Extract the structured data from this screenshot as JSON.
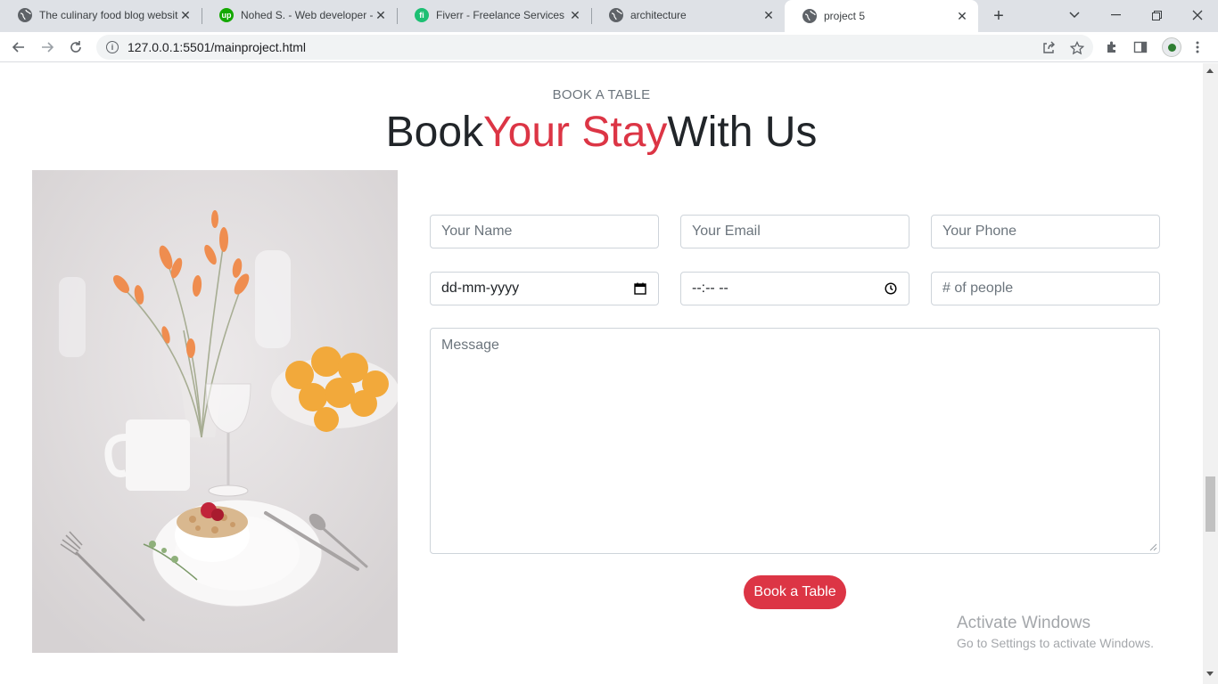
{
  "browser": {
    "tabs": [
      {
        "title": "The culinary food blog website",
        "favicon": "globe-icon",
        "active": false
      },
      {
        "title": "Nohed S. - Web developer - Upwork",
        "favicon": "upwork-icon",
        "active": false
      },
      {
        "title": "Fiverr - Freelance Services Marketplace",
        "favicon": "fiverr-icon",
        "active": false
      },
      {
        "title": "architecture",
        "favicon": "globe-icon",
        "active": false
      },
      {
        "title": "project 5",
        "favicon": "globe-icon",
        "active": true
      }
    ],
    "url": "127.0.0.1:5501/mainproject.html"
  },
  "section": {
    "eyebrow": "BOOK A TABLE",
    "heading_part1": "Book",
    "heading_accent": "Your Stay",
    "heading_part2": "With Us"
  },
  "form": {
    "name_placeholder": "Your Name",
    "email_placeholder": "Your Email",
    "phone_placeholder": "Your Phone",
    "date_value": "dd-mm-yyyy",
    "time_value": "--:-- --",
    "people_placeholder": "# of people",
    "message_placeholder": "Message",
    "submit_label": "Book a Table"
  },
  "watermark": {
    "line1": "Activate Windows",
    "line2": "Go to Settings to activate Windows."
  },
  "colors": {
    "accent": "#dc3545",
    "text": "#212529",
    "muted": "#6c757d"
  }
}
